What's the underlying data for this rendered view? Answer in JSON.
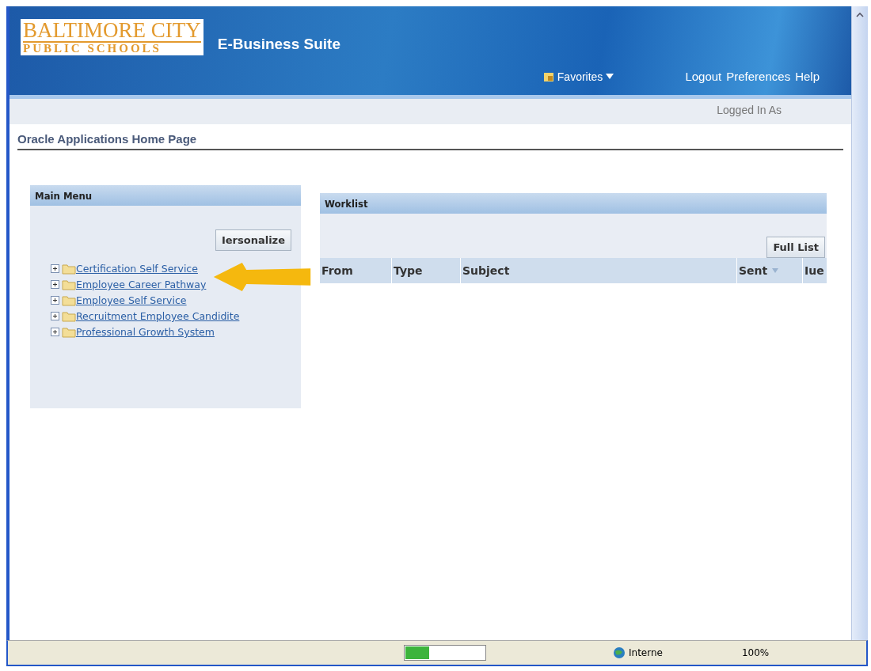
{
  "header": {
    "logo": {
      "line_1": "BALTIMORE CITY",
      "line_2": "PUBLIC SCHOOLS"
    },
    "suite_title": "E-Business Suite",
    "favorites": "Favorites",
    "global_links": [
      "Logout",
      "Preferences",
      "Help"
    ]
  },
  "logged_in_as": "Logged In As",
  "page_title": "Oracle Applications Home Page",
  "main_menu": {
    "title": "Main Menu",
    "personalize_button": "Iersonalize",
    "items": [
      {
        "label": "Certification Self Service",
        "expanded": false
      },
      {
        "label": "Employee Career Pathway",
        "expanded": false
      },
      {
        "label": "Employee Self Service",
        "expanded": false
      },
      {
        "label": "Recruitment Employee Candidite",
        "expanded": false
      },
      {
        "label": "Professional Growth System",
        "expanded": false
      }
    ]
  },
  "worklist": {
    "title": "Worklist",
    "full_list_button": "Full List",
    "columns": [
      {
        "label": "From",
        "sorted": false
      },
      {
        "label": "Type",
        "sorted": false
      },
      {
        "label": "Subject",
        "sorted": false
      },
      {
        "label": "Sent",
        "sorted": true
      },
      {
        "label": "Iue",
        "sorted": false
      }
    ]
  },
  "status_bar": {
    "progress": {
      "level": 0.3
    },
    "zone": "Interne",
    "zoom": "100%"
  }
}
